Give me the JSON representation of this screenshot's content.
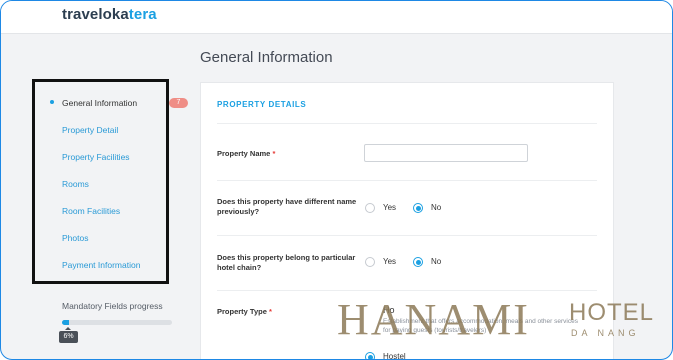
{
  "app": {
    "logo_main": "traveloka",
    "logo_accent": "tera"
  },
  "page": {
    "title": "General Information"
  },
  "sidebar": {
    "items": [
      {
        "label": "General Information"
      },
      {
        "label": "Property Detail"
      },
      {
        "label": "Property Facilities"
      },
      {
        "label": "Rooms"
      },
      {
        "label": "Room Facilities"
      },
      {
        "label": "Photos"
      },
      {
        "label": "Payment Information"
      }
    ],
    "badge": "7",
    "progress": {
      "label": "Mandatory Fields progress",
      "value_text": "6%",
      "value": 0.06
    }
  },
  "form": {
    "section_title": "PROPERTY DETAILS",
    "property_name": {
      "label": "Property Name",
      "required_mark": "*",
      "value": ""
    },
    "different_name": {
      "label": "Does this property have different name previously?",
      "yes_label": "Yes",
      "no_label": "No",
      "selected": "No"
    },
    "hotel_chain": {
      "label": "Does this property belong to particular hotel chain?",
      "yes_label": "Yes",
      "no_label": "No",
      "selected": "No"
    },
    "property_type": {
      "label": "Property Type",
      "required_mark": "*",
      "options": [
        {
          "title": "Ho",
          "desc": "Establishment that offers accommodation, meals and other services for paying guests (tourists/travelers)"
        },
        {
          "title": "Hostel",
          "desc": ""
        }
      ]
    }
  },
  "watermark": {
    "main": "HANAMI",
    "hotel": "HOTEL",
    "city": "DA NANG"
  },
  "colors": {
    "accent": "#1ba0e2",
    "badge": "#ef8d86",
    "required": "#e53935"
  }
}
